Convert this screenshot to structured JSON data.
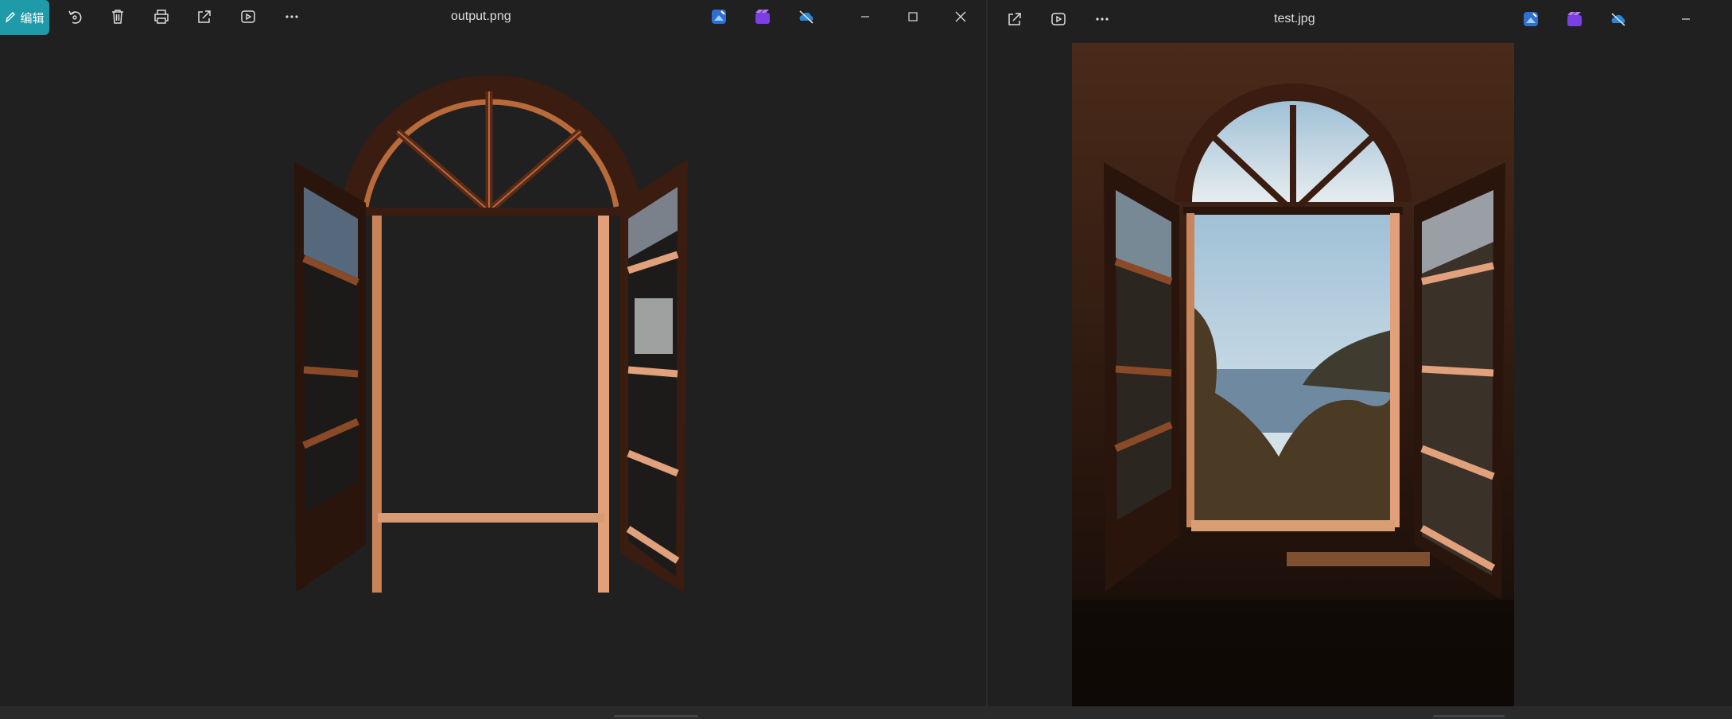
{
  "left_window": {
    "edit_button_label": "编辑",
    "title": "output.png",
    "toolbar_icons": [
      "rotate-icon",
      "delete-icon",
      "print-icon",
      "share-icon",
      "slideshow-icon",
      "more-icon"
    ],
    "app_icons": [
      "photo-editor-icon",
      "clipchamp-icon",
      "onedrive-off-icon"
    ],
    "window_controls": [
      "minimize",
      "maximize",
      "close"
    ]
  },
  "right_window": {
    "title": "test.jpg",
    "toolbar_icons": [
      "share-icon",
      "slideshow-icon",
      "more-icon"
    ],
    "app_icons": [
      "photo-editor-icon",
      "clipchamp-icon",
      "onedrive-off-icon"
    ],
    "window_controls": [
      "minimize"
    ]
  },
  "colors": {
    "accent": "#1f9aa8",
    "background": "#202020",
    "window_frame": "#8a4a28"
  }
}
